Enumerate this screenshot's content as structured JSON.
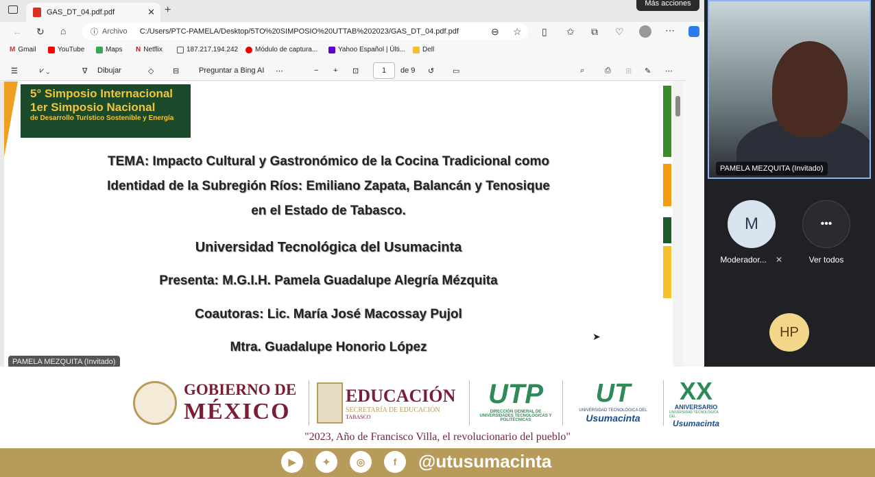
{
  "browser": {
    "tab_title": "GAS_DT_04.pdf.pdf",
    "more_actions": "Más acciones",
    "address_label": "Archivo",
    "url": "C:/Users/PTC-PAMELA/Desktop/5TO%20SIMPOSIO%20UTTAB%202023/GAS_DT_04.pdf.pdf",
    "bookmarks": [
      "Gmail",
      "YouTube",
      "Maps",
      "Netflix",
      "187.217.194.242",
      "Módulo de captura...",
      "Yahoo Español | Últi...",
      "Dell"
    ]
  },
  "pdf_toolbar": {
    "draw": "Dibujar",
    "ask_bing": "Preguntar a Bing AI",
    "page": "1",
    "of_pages": "de 9"
  },
  "document": {
    "logo_line1": "5° Simposio Internacional",
    "logo_line2": "1er Simposio Nacional",
    "logo_line3": "de Desarrollo Turístico Sostenible y Energía",
    "tema_line1": "TEMA:  Impacto Cultural y Gastronómico de la Cocina Tradicional como",
    "tema_line2": "Identidad de la Subregión Ríos: Emiliano Zapata, Balancán y Tenosique",
    "tema_line3": "en el Estado de Tabasco.",
    "university": "Universidad Tecnológica del Usumacinta",
    "presenter": "Presenta: M.G.I.H. Pamela Guadalupe Alegría Mézquita",
    "coauthors": "Coautoras: Lic. María José Macossay Pujol",
    "coauthor2": "Mtra. Guadalupe Honorio López"
  },
  "presenter_tag": "PAMELA MEZQUITA (Invitado)",
  "meeting": {
    "video_label": "PAMELA MEZQUITA (Invitado)",
    "moderator_initial": "M",
    "moderator_label": "Moderador...",
    "see_all_icon": "•••",
    "see_all": "Ver todos",
    "hp_initials": "HP"
  },
  "banner": {
    "gob1": "GOBIERNO DE",
    "gob2": "MÉXICO",
    "edu1": "EDUCACIÓN",
    "edu2": "SECRETARÍA DE EDUCACIÓN",
    "edu3": "TABASCO",
    "utp": "UTP",
    "utp_sub": "DIRECCIÓN GENERAL DE UNIVERSIDADES TECNOLÓGICAS Y POLITÉCNICAS",
    "ut": "UT",
    "ut_sub": "UNIVERSIDAD TECNOLÓGICA DEL",
    "usumacinta": "Usumacinta",
    "xx": "XX",
    "aniv": "ANIVERSARIO",
    "aniv_sub": "UNIVERSIDAD TECNOLÓGICA DEL",
    "aniv_usu": "Usumacinta",
    "quote": "\"2023, Año de Francisco Villa, el revolucionario del pueblo\""
  },
  "footer": {
    "handle": "@utusumacinta",
    "icons": [
      "youtube-icon",
      "twitter-icon",
      "instagram-icon",
      "facebook-icon"
    ]
  }
}
